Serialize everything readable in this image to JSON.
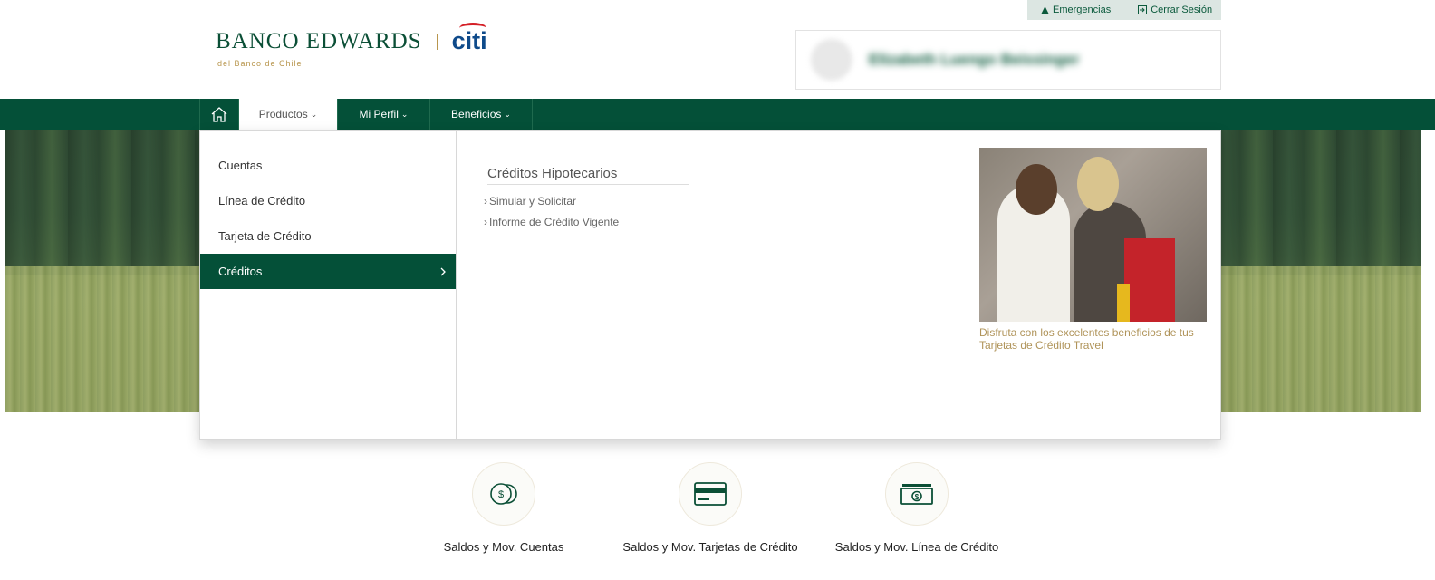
{
  "top_bar": {
    "emergencias_label": "Emergencias",
    "cerrar_sesion_label": "Cerrar Sesión"
  },
  "logo": {
    "brand": "BANCO EDWARDS",
    "partner": "citi",
    "tagline": "del Banco de Chile"
  },
  "user": {
    "name": "Elizabeth Luengo Beissinger"
  },
  "nav": {
    "home_icon": "home-icon",
    "items": [
      {
        "label": "Productos"
      },
      {
        "label": "Mi Perfil"
      },
      {
        "label": "Beneficios"
      }
    ]
  },
  "menu": {
    "left_items": [
      {
        "label": "Cuentas"
      },
      {
        "label": "Línea de Crédito"
      },
      {
        "label": "Tarjeta de Crédito"
      },
      {
        "label": "Créditos"
      }
    ],
    "section_title": "Créditos Hipotecarios",
    "links": [
      {
        "label": "Simular y Solicitar"
      },
      {
        "label": "Informe de Crédito Vigente"
      }
    ],
    "promo_caption": "Disfruta con los excelentes beneficios de tus Tarjetas de Crédito Travel"
  },
  "shortcuts": [
    {
      "label": "Saldos y Mov. Cuentas",
      "icon": "coins-icon"
    },
    {
      "label": "Saldos y Mov. Tarjetas de Crédito",
      "icon": "credit-card-icon"
    },
    {
      "label": "Saldos y Mov. Línea de Crédito",
      "icon": "cash-icon"
    }
  ],
  "colors": {
    "brand_green": "#045038",
    "accent_gold": "#b8964e",
    "citi_blue": "#0e4a8a"
  }
}
